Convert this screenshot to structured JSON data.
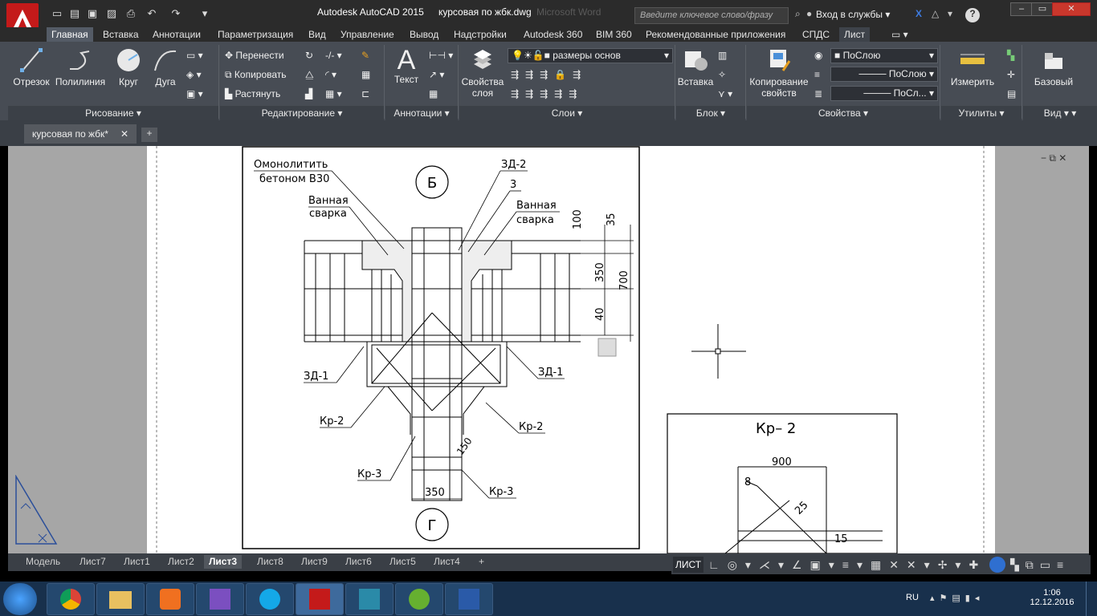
{
  "app": {
    "title": "Autodesk AutoCAD 2015",
    "file": "курсовая по жбк.dwg",
    "ghost_title": "Microsoft Word"
  },
  "search": {
    "placeholder": "Введите ключевое слово/фразу"
  },
  "signin": "Вход в службы",
  "ribbon_tabs": [
    "Главная",
    "Вставка",
    "Аннотации",
    "Параметризация",
    "Вид",
    "Управление",
    "Вывод",
    "Надстройки",
    "Autodesk 360",
    "BIM 360",
    "Рекомендованные приложения",
    "СПДС",
    "Лист"
  ],
  "draw": {
    "line": "Отрезок",
    "polyline": "Полилиния",
    "circle": "Круг",
    "arc": "Дуга"
  },
  "modify": {
    "move": "Перенести",
    "copy": "Копировать",
    "stretch": "Растянуть"
  },
  "annot": {
    "text": "Текст"
  },
  "layers": {
    "props": "Свойства слоя",
    "current": "размеры основ"
  },
  "block": {
    "insert": "Вставка"
  },
  "props": {
    "match": "Копирование свойств",
    "color": "ПоСлою",
    "linetype": "ПоСлою",
    "lineweight": "ПоСл..."
  },
  "util": {
    "measure": "Измерить"
  },
  "view": {
    "base": "Базовый"
  },
  "panels": {
    "draw": "Рисование",
    "modify": "Редактирование",
    "annot": "Аннотации",
    "layers": "Слои",
    "block": "Блок",
    "props": "Свойства",
    "util": "Утилиты",
    "view": "Вид"
  },
  "doc_tab": "курсовая по жбк*",
  "layout_tabs": [
    "Модель",
    "Лист7",
    "Лист1",
    "Лист2",
    "Лист3",
    "Лист8",
    "Лист9",
    "Лист6",
    "Лист5",
    "Лист4"
  ],
  "active_layout": "Лист3",
  "status": {
    "space": "ЛИСТ"
  },
  "drawing": {
    "note1": "Омонолитить",
    "note2": "бетоном B30",
    "weld": "Ванная",
    "weld2": "сварка",
    "zd1": "ЗД-1",
    "zd2": "ЗД-2",
    "n3": "3",
    "kr2": "Кр-2",
    "kr3": "Кр-3",
    "axis_b": "Б",
    "axis_g": "Г",
    "d100": "100",
    "d35": "35",
    "d350": "350",
    "d700": "700",
    "d40": "40",
    "d150": "150",
    "w350": "350"
  },
  "detail": {
    "title": "Кр– 2",
    "d900": "900",
    "d8": "8",
    "d25": "25",
    "d15": "15"
  },
  "tray": {
    "lang": "RU",
    "time": "1:06",
    "date": "12.12.2016"
  }
}
